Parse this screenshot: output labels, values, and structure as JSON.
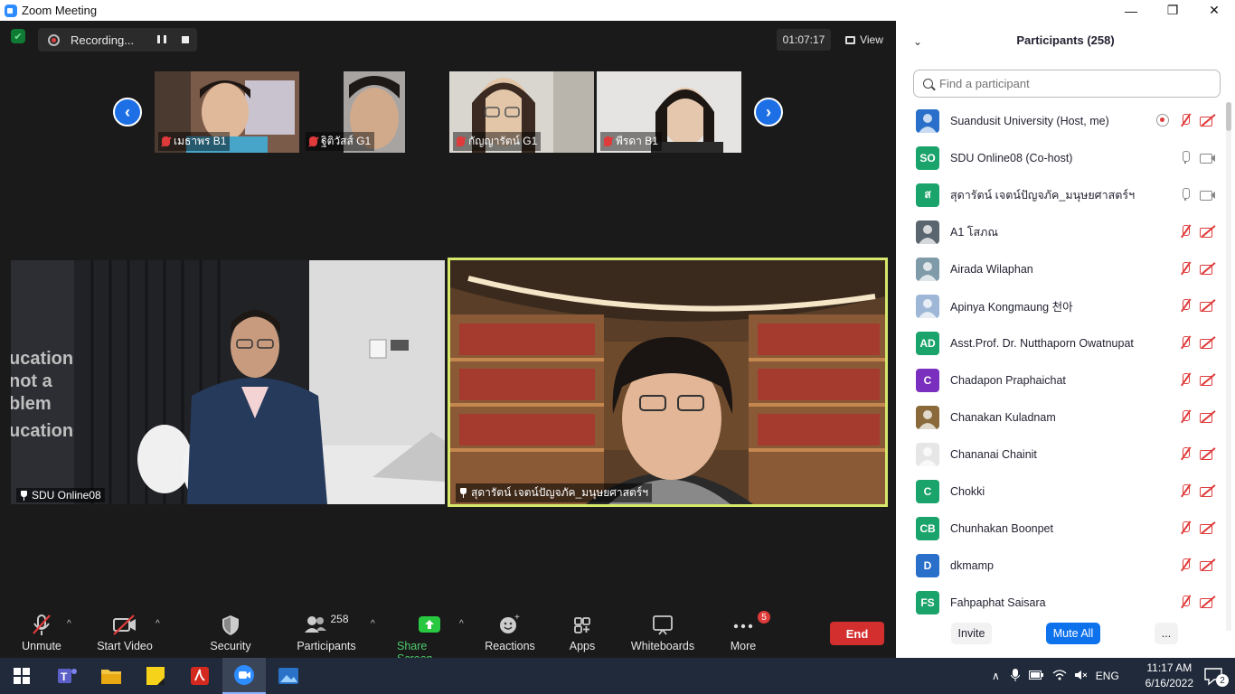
{
  "window": {
    "title": "Zoom Meeting",
    "controls": {
      "minimize": "—",
      "maximize": "❐",
      "close": "✕"
    }
  },
  "top_bar": {
    "recording_label": "Recording...",
    "timer": "01:07:17",
    "view_label": "View"
  },
  "thumbnails": [
    {
      "name": "เมธาพร B1"
    },
    {
      "name": "ฐิติวัสส์ G1"
    },
    {
      "name": "กัญญารัตน์ G1"
    },
    {
      "name": "พีรดา B1"
    }
  ],
  "videos": [
    {
      "name": "SDU Online08"
    },
    {
      "name": "สุดารัตน์ เจตน์ปัญจภัค_มนุษยศาสตร์ฯ"
    }
  ],
  "toolbar": {
    "unmute": "Unmute",
    "start_video": "Start Video",
    "security": "Security",
    "participants": "Participants",
    "participants_count": "258",
    "share_screen": "Share Screen",
    "reactions": "Reactions",
    "apps": "Apps",
    "whiteboards": "Whiteboards",
    "more": "More",
    "more_badge": "5",
    "end": "End"
  },
  "panel": {
    "title": "Participants (258)",
    "search_placeholder": "Find a participant",
    "invite": "Invite",
    "mute_all": "Mute All",
    "more": "...",
    "participants": [
      {
        "name": "Suandusit University (Host, me)",
        "initials": "",
        "color": "#2a6fc9",
        "mic": "off",
        "video": "off",
        "recording": true
      },
      {
        "name": "SDU Online08 (Co-host)",
        "initials": "SO",
        "color": "#1aa36a",
        "mic": "on",
        "video": "on",
        "recording": false
      },
      {
        "name": "สุดารัตน์ เจตน์ปัญจภัค_มนุษยศาสตร์ฯ",
        "initials": "ส",
        "color": "#1aa36a",
        "mic": "on",
        "video": "on",
        "recording": false
      },
      {
        "name": "A1 โสภณ",
        "initials": "",
        "color": "#5b6570",
        "mic": "off",
        "video": "off",
        "recording": false
      },
      {
        "name": "Airada Wilaphan",
        "initials": "",
        "color": "#7f9aa8",
        "mic": "off",
        "video": "off",
        "recording": false
      },
      {
        "name": "Apinya Kongmaung 천아",
        "initials": "",
        "color": "#9fb7d6",
        "mic": "off",
        "video": "off",
        "recording": false
      },
      {
        "name": "Asst.Prof. Dr. Nutthaporn Owatnupat",
        "initials": "AD",
        "color": "#1aa36a",
        "mic": "off",
        "video": "off",
        "recording": false
      },
      {
        "name": "Chadapon Praphaichat",
        "initials": "C",
        "color": "#7b2fbe",
        "mic": "off",
        "video": "off",
        "recording": false
      },
      {
        "name": "Chanakan Kuladnam",
        "initials": "",
        "color": "#8a6a3a",
        "mic": "off",
        "video": "off",
        "recording": false
      },
      {
        "name": "Chananai Chainit",
        "initials": "",
        "color": "#e6e6e6",
        "mic": "off",
        "video": "off",
        "recording": false
      },
      {
        "name": "Chokki",
        "initials": "C",
        "color": "#1aa36a",
        "mic": "off",
        "video": "off",
        "recording": false
      },
      {
        "name": "Chunhakan Boonpet",
        "initials": "CB",
        "color": "#1aa36a",
        "mic": "off",
        "video": "off",
        "recording": false
      },
      {
        "name": "dkmamp",
        "initials": "D",
        "color": "#2a6fc9",
        "mic": "off",
        "video": "off",
        "recording": false
      },
      {
        "name": "Fahpaphat Saisara",
        "initials": "FS",
        "color": "#1aa36a",
        "mic": "off",
        "video": "off",
        "recording": false
      }
    ]
  },
  "taskbar": {
    "language": "ENG",
    "time": "11:17 AM",
    "date": "6/16/2022",
    "notifications": "2"
  }
}
